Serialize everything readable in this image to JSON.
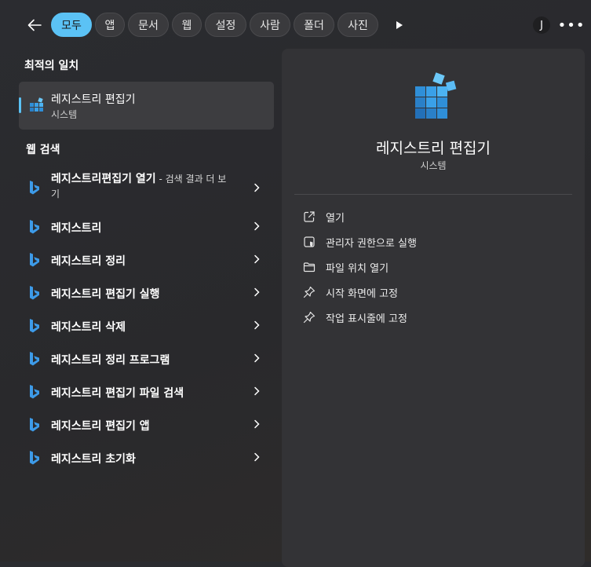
{
  "filters": [
    "모두",
    "앱",
    "문서",
    "웹",
    "설정",
    "사람",
    "폴더",
    "사진"
  ],
  "account_initial": "J",
  "more_label": "•••",
  "best_match": {
    "heading": "최적의 일치",
    "name": "레지스트리 편집기",
    "type": "시스템"
  },
  "web_search": {
    "heading": "웹 검색",
    "first": {
      "bold": "레지스트리편집기 열기",
      "rest": " - 검색 결과 더 보기"
    },
    "items": [
      {
        "text": "레지스트리",
        "weight": "normal"
      },
      {
        "text": "레지스트리 정리",
        "weight": "bold"
      },
      {
        "text": "레지스트리 편집기 실행",
        "weight": "bold"
      },
      {
        "text": "레지스트리 삭제",
        "weight": "bold"
      },
      {
        "text": "레지스트리 정리 프로그램",
        "weight": "bold"
      },
      {
        "text": "레지스트리 편집기 파일 검색",
        "weight": "bold"
      },
      {
        "text": "레지스트리 편집기 앱",
        "weight": "bold"
      },
      {
        "text": "레지스트리 초기화",
        "weight": "bold"
      }
    ]
  },
  "detail": {
    "title": "레지스트리 편집기",
    "subtitle": "시스템",
    "actions": [
      {
        "label": "열기",
        "icon": "open-external-icon"
      },
      {
        "label": "관리자 권한으로 실행",
        "icon": "shield-run-icon"
      },
      {
        "label": "파일 위치 열기",
        "icon": "folder-icon"
      },
      {
        "label": "시작 화면에 고정",
        "icon": "pin-icon"
      },
      {
        "label": "작업 표시줄에 고정",
        "icon": "pin-icon"
      }
    ]
  },
  "colors": {
    "accent": "#5bc2f5",
    "panel": "#333336",
    "background": "#2b2c30"
  }
}
